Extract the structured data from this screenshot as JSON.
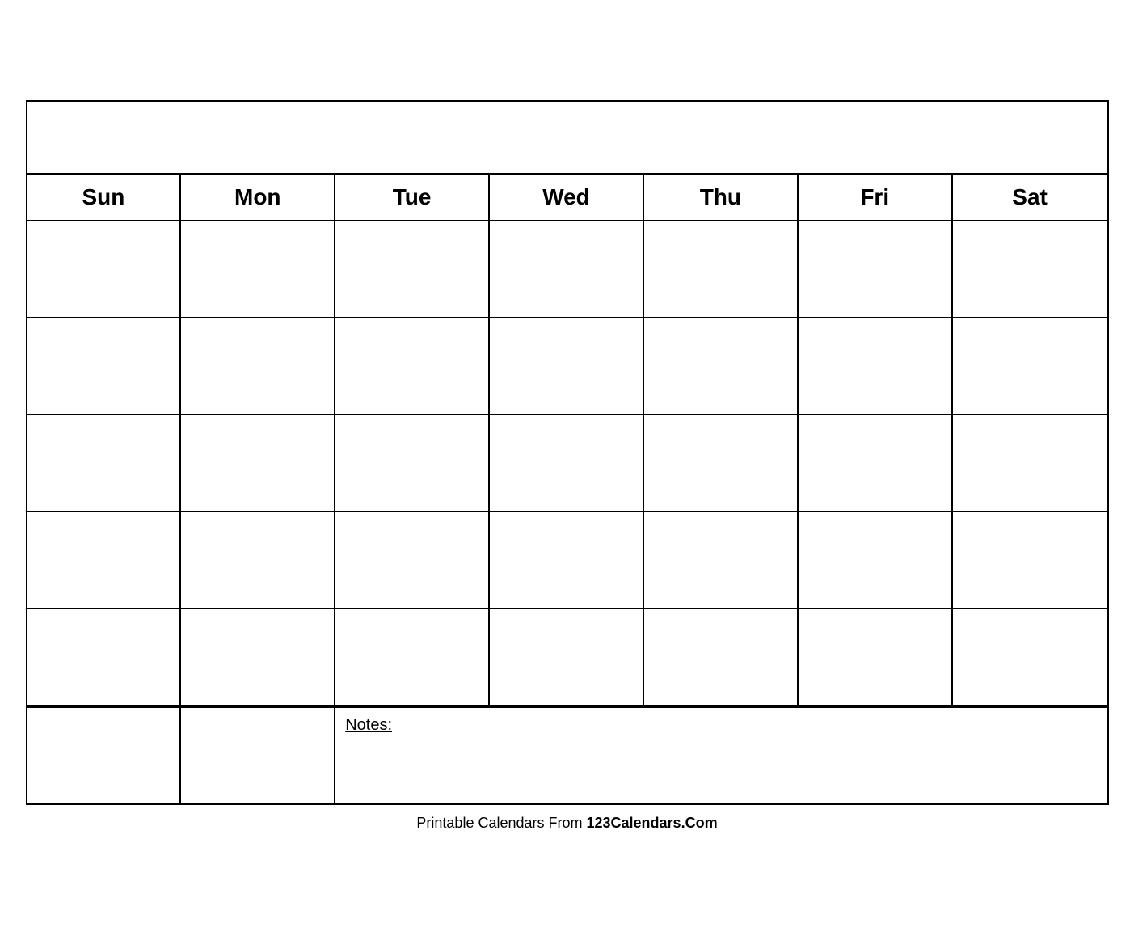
{
  "calendar": {
    "title": "",
    "days": [
      "Sun",
      "Mon",
      "Tue",
      "Wed",
      "Thu",
      "Fri",
      "Sat"
    ],
    "rows": 5,
    "notes_label": "Notes:"
  },
  "footer": {
    "text_plain": "Printable Calendars From ",
    "text_bold": "123Calendars.Com"
  }
}
